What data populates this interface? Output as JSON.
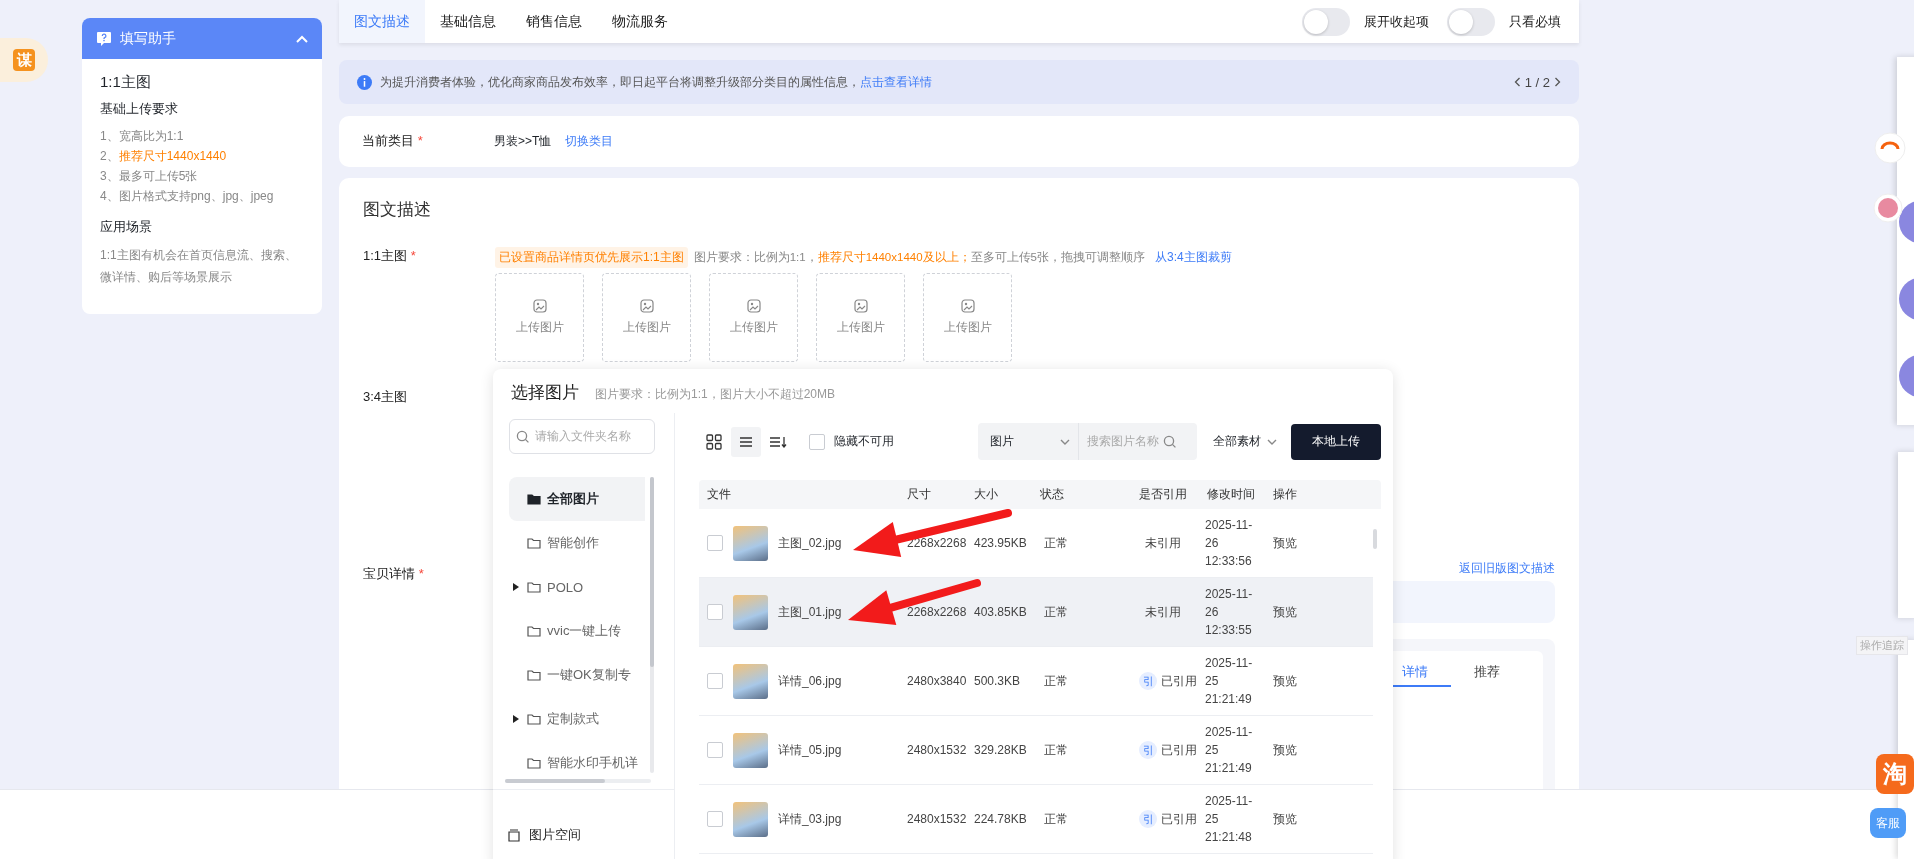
{
  "side_badge": {
    "text": "谋"
  },
  "helper": {
    "title": "填写助手",
    "expanded": true,
    "section_title": "1:1主图",
    "requirements": {
      "heading": "基础上传要求",
      "items": [
        {
          "number": "1、",
          "text": "宽高比为1:1",
          "highlighted": false
        },
        {
          "number": "2、",
          "text": "推荐尺寸1440x1440",
          "highlighted": true
        },
        {
          "number": "3、",
          "text": "最多可上传5张",
          "highlighted": false
        },
        {
          "number": "4、",
          "text": "图片格式支持png、jpg、jpeg",
          "highlighted": false
        }
      ]
    },
    "scenarios": {
      "heading": "应用场景",
      "text": "1:1主图有机会在首页信息流、搜索、微详情、购后等场景展示"
    }
  },
  "tabs": [
    {
      "label": "图文描述",
      "selected": true
    },
    {
      "label": "基础信息",
      "selected": false
    },
    {
      "label": "销售信息",
      "selected": false
    },
    {
      "label": "物流服务",
      "selected": false
    }
  ],
  "toggles": [
    {
      "label": "展开收起项",
      "on": false
    },
    {
      "label": "只看必填",
      "on": false
    }
  ],
  "notice": {
    "text": "为提升消费者体验，优化商家商品发布效率，即日起平台将调整升级部分类目的属性信息，",
    "link": "点击查看详情",
    "page": "1 / 2"
  },
  "category": {
    "label": "当前类目",
    "mark": "*",
    "value": "男装>>T恤",
    "link": "切换类目"
  },
  "main_card": {
    "title": "图文描述",
    "main_image": {
      "label": "1:1主图",
      "mark": "*",
      "tag": "已设置商品详情页优先展示1:1主图",
      "requirement": [
        {
          "text": "图片要求：比例为1:1，",
          "highlighted": false
        },
        {
          "text": "推荐尺寸1440x1440及以上；",
          "highlighted": true
        },
        {
          "text": "至多可上传5张，拖拽可调整顺序",
          "highlighted": false
        }
      ],
      "link": "从3:4主图裁剪",
      "slots": [
        {
          "label": "上传图片"
        },
        {
          "label": "上传图片"
        },
        {
          "label": "上传图片"
        },
        {
          "label": "上传图片"
        },
        {
          "label": "上传图片"
        }
      ]
    },
    "portrait_image": {
      "label": "3:4主图"
    },
    "detail": {
      "label": "宝贝详情",
      "mark": "*",
      "back_link": "返回旧版图文描述",
      "tabs": [
        {
          "label": "详情",
          "selected": true
        },
        {
          "label": "推荐",
          "selected": false
        }
      ]
    }
  },
  "dialog": {
    "title": "选择图片",
    "hint": "图片要求：比例为1:1，图片大小不超过20MB",
    "folder_search": {
      "placeholder": "请输入文件夹名称"
    },
    "folders": [
      {
        "name": "全部图片",
        "selected": true,
        "has_children": false
      },
      {
        "name": "智能创作",
        "selected": false,
        "has_children": false
      },
      {
        "name": "POLO",
        "selected": false,
        "has_children": true
      },
      {
        "name": "vvic一键上传",
        "selected": false,
        "has_children": false
      },
      {
        "name": "一键OK复制专",
        "selected": false,
        "has_children": false
      },
      {
        "name": "定制款式",
        "selected": false,
        "has_children": true
      },
      {
        "name": "智能水印手机详",
        "selected": false,
        "has_children": false
      }
    ],
    "footer_label": "图片空间",
    "view_modes": [
      {
        "kind": "grid",
        "selected": false
      },
      {
        "kind": "list",
        "selected": true
      },
      {
        "kind": "sort",
        "selected": false
      }
    ],
    "hide_unavailable": {
      "label": "隐藏不可用",
      "checked": false
    },
    "type_select": {
      "value": "图片"
    },
    "image_search": {
      "placeholder": "搜索图片名称"
    },
    "material_filter": {
      "value": "全部素材"
    },
    "upload_button": "本地上传",
    "table": {
      "columns": [
        "文件",
        "尺寸",
        "大小",
        "状态",
        "是否引用",
        "修改时间",
        "操作"
      ],
      "rows": [
        {
          "checked": false,
          "highlighted": false,
          "file": "主图_02.jpg",
          "size": "2268x2268",
          "bytes": "423.95KB",
          "status": "正常",
          "reference": "未引用",
          "modified": "2025-11-26 12:33:56",
          "action": "预览"
        },
        {
          "checked": false,
          "highlighted": true,
          "file": "主图_01.jpg",
          "size": "2268x2268",
          "bytes": "403.85KB",
          "status": "正常",
          "reference": "未引用",
          "modified": "2025-11-26 12:33:55",
          "action": "预览"
        },
        {
          "checked": false,
          "highlighted": false,
          "file": "详情_06.jpg",
          "size": "2480x3840",
          "bytes": "500.3KB",
          "status": "正常",
          "ref_badge": "引",
          "reference": "已引用",
          "modified": "2025-11-25 21:21:49",
          "action": "预览"
        },
        {
          "checked": false,
          "highlighted": false,
          "file": "详情_05.jpg",
          "size": "2480x1532",
          "bytes": "329.28KB",
          "status": "正常",
          "ref_badge": "引",
          "reference": "已引用",
          "modified": "2025-11-25 21:21:49",
          "action": "预览"
        },
        {
          "checked": false,
          "highlighted": false,
          "file": "详情_03.jpg",
          "size": "2480x1532",
          "bytes": "224.78KB",
          "status": "正常",
          "ref_badge": "引",
          "reference": "已引用",
          "modified": "2025-11-25 21:21:48",
          "action": "预览"
        }
      ]
    }
  },
  "right_widgets": {
    "trace_label": "操作追踪",
    "taobao": "淘",
    "service": "客服"
  }
}
